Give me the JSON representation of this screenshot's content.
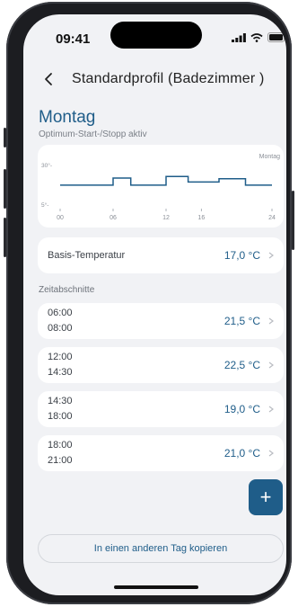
{
  "status": {
    "time": "09:41"
  },
  "header": {
    "title": "Standardprofil (Badezimmer )"
  },
  "day": {
    "name": "Montag",
    "subtitle": "Optimum-Start-/Stopp aktiv"
  },
  "chart_data": {
    "type": "line",
    "title": "Montag",
    "xlabel": "",
    "ylabel": "",
    "ylim": [
      5,
      30
    ],
    "xlim": [
      0,
      24
    ],
    "y_ticks": [
      "30°-",
      "5°-"
    ],
    "x_ticks": [
      "00",
      "06",
      "12",
      "16",
      "24"
    ],
    "x_tick_values": [
      0,
      6,
      12,
      16,
      24
    ],
    "series": [
      {
        "x": [
          0,
          6,
          6,
          8,
          8,
          12,
          12,
          14.5,
          14.5,
          18,
          18,
          21,
          21,
          24
        ],
        "y": [
          17,
          17,
          21.5,
          21.5,
          17,
          17,
          22.5,
          22.5,
          19,
          19,
          21,
          21,
          17,
          17
        ]
      }
    ],
    "color": "#1f5d89"
  },
  "base": {
    "label": "Basis-Temperatur",
    "value": "17,0 °C"
  },
  "section": {
    "label": "Zeitabschnitte"
  },
  "periods": [
    {
      "start": "06:00",
      "end": "08:00",
      "value": "21,5 °C"
    },
    {
      "start": "12:00",
      "end": "14:30",
      "value": "22,5 °C"
    },
    {
      "start": "14:30",
      "end": "18:00",
      "value": "19,0 °C"
    },
    {
      "start": "18:00",
      "end": "21:00",
      "value": "21,0 °C"
    }
  ],
  "fab": {
    "label": "+"
  },
  "copy_button": {
    "label": "In einen anderen Tag kopieren"
  },
  "colors": {
    "accent": "#1f5d89",
    "background": "#f1f2f5"
  }
}
